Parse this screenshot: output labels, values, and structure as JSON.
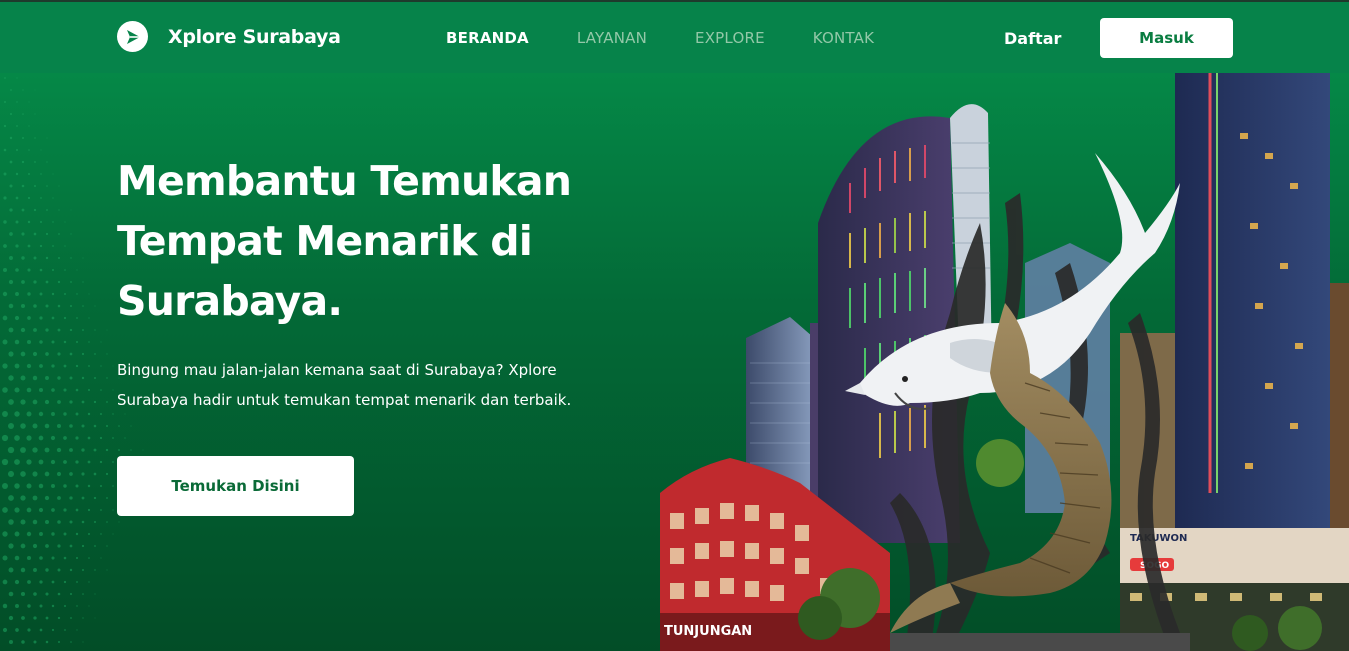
{
  "brand": {
    "name": "Xplore Surabaya",
    "logo_icon": "play-arrow-icon"
  },
  "nav": {
    "items": [
      {
        "label": "BERANDA",
        "active": true
      },
      {
        "label": "LAYANAN",
        "active": false
      },
      {
        "label": "EXPLORE",
        "active": false
      },
      {
        "label": "KONTAK",
        "active": false
      }
    ],
    "register_label": "Daftar",
    "login_label": "Masuk"
  },
  "hero": {
    "headline_lines": [
      "Membantu Temukan",
      "Tempat Menarik di",
      "Surabaya."
    ],
    "subtext_lines": [
      "Bingung mau jalan-jalan kemana saat di Surabaya? Xplore",
      "Surabaya hadir untuk temukan tempat menarik dan terbaik."
    ],
    "cta_label": "Temukan Disini",
    "image_signs": {
      "tunjungan": "TUNJUNGAN",
      "mall": "TAKUWON",
      "sogo": "SOGO"
    }
  },
  "colors": {
    "nav_bg": "#06834a",
    "hero_top": "#058847",
    "hero_bottom": "#024d27",
    "button_text": "#0a7d41",
    "nav_inactive": "#93c8a8"
  }
}
